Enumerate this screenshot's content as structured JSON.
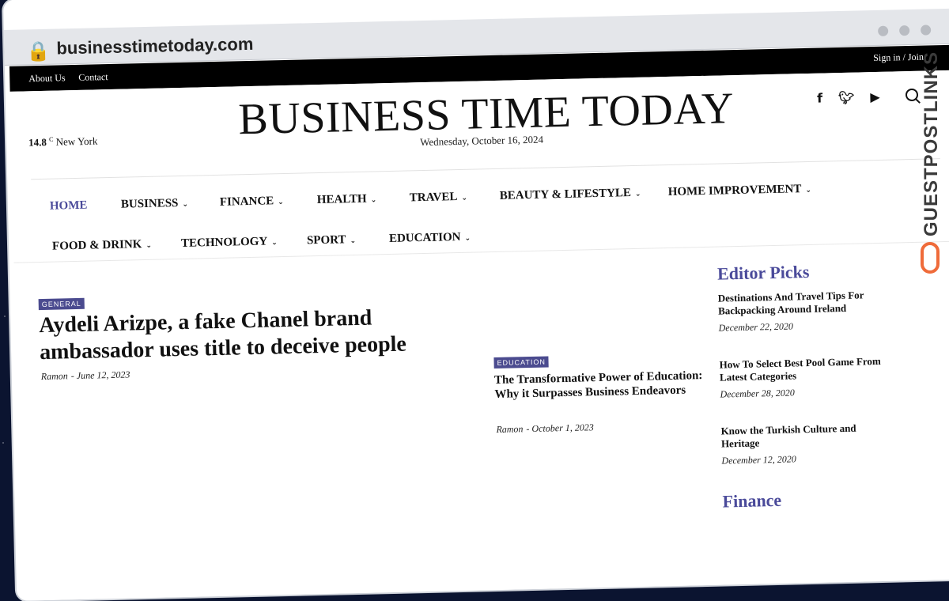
{
  "browser": {
    "url": "businesstimetoday.com",
    "lock_icon": "lock-icon"
  },
  "topbar": {
    "links": [
      "About Us",
      "Contact"
    ],
    "signin": "Sign in / Join"
  },
  "header": {
    "weather_temp": "14.8",
    "weather_unit": "C",
    "weather_city": "New York",
    "title": "BUSINESS TIME TODAY",
    "date": "Wednesday, October 16, 2024",
    "social_icons": [
      "facebook-icon",
      "twitter-icon",
      "youtube-icon"
    ]
  },
  "nav": {
    "items": [
      {
        "label": "HOME"
      },
      {
        "label": "BUSINESS"
      },
      {
        "label": "FINANCE"
      },
      {
        "label": "HEALTH"
      },
      {
        "label": "TRAVEL"
      },
      {
        "label": "BEAUTY & LIFESTYLE"
      },
      {
        "label": "HOME IMPROVEMENT"
      },
      {
        "label": "FOOD & DRINK"
      },
      {
        "label": "TECHNOLOGY"
      },
      {
        "label": "SPORT"
      },
      {
        "label": "EDUCATION"
      }
    ]
  },
  "main_article": {
    "category": "GENERAL",
    "title": "Aydeli Arizpe, a fake Chanel brand ambassador uses title to deceive people",
    "author": "Ramon",
    "date": "- June 12, 2023"
  },
  "second_article": {
    "category": "EDUCATION",
    "title": "The Transformative Power of Education: Why it Surpasses Business Endeavors",
    "author": "Ramon",
    "date": "- October 1, 2023"
  },
  "editor_picks": {
    "heading": "Editor Picks",
    "items": [
      {
        "title": "Destinations And Travel Tips For Backpacking Around Ireland",
        "date": "December 22, 2020"
      },
      {
        "title": "How To Select Best Pool Game From Latest Categories",
        "date": "December 28, 2020"
      },
      {
        "title": "Know the Turkish Culture and Heritage",
        "date": "December 12, 2020"
      }
    ]
  },
  "finance_heading": "Finance",
  "watermark": "GUESTPOSTLINKS",
  "colors": {
    "accent": "#4a4a9a",
    "category_bg": "#4b4b8f",
    "watermark_logo": "#ef6b3a"
  }
}
